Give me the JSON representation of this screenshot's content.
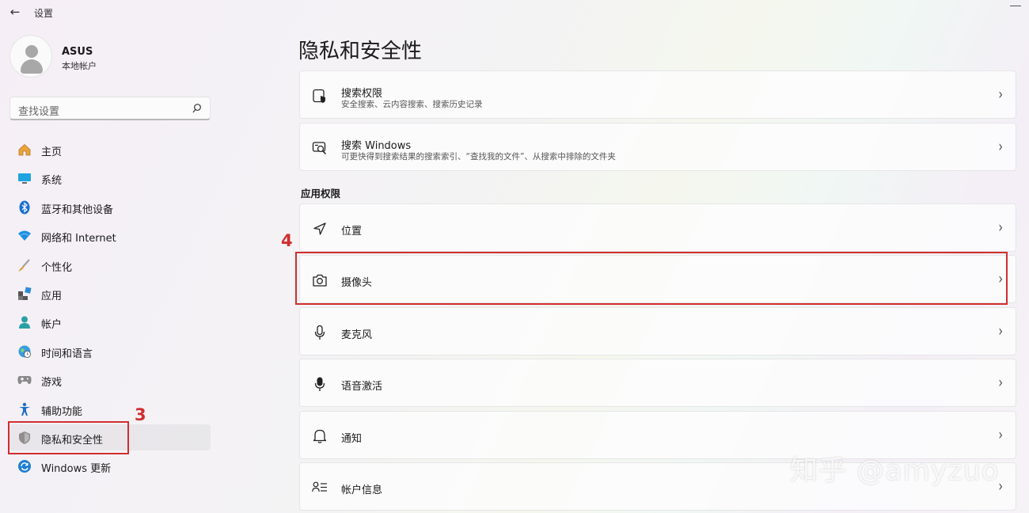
{
  "window": {
    "app_title": "设置"
  },
  "profile": {
    "name": "ASUS",
    "account_type": "本地帐户"
  },
  "search": {
    "placeholder": "查找设置"
  },
  "sidebar": {
    "items": [
      {
        "label": "主页",
        "icon": "home-icon"
      },
      {
        "label": "系统",
        "icon": "system-icon"
      },
      {
        "label": "蓝牙和其他设备",
        "icon": "bluetooth-icon"
      },
      {
        "label": "网络和 Internet",
        "icon": "wifi-icon"
      },
      {
        "label": "个性化",
        "icon": "brush-icon"
      },
      {
        "label": "应用",
        "icon": "apps-icon"
      },
      {
        "label": "帐户",
        "icon": "account-icon"
      },
      {
        "label": "时间和语言",
        "icon": "globe-clock-icon"
      },
      {
        "label": "游戏",
        "icon": "gamepad-icon"
      },
      {
        "label": "辅助功能",
        "icon": "accessibility-icon"
      },
      {
        "label": "隐私和安全性",
        "icon": "shield-icon",
        "selected": true
      },
      {
        "label": "Windows 更新",
        "icon": "update-icon"
      }
    ]
  },
  "main": {
    "title": "隐私和安全性",
    "top_cards": [
      {
        "title": "搜索权限",
        "desc": "安全搜索、云内容搜索、搜索历史记录",
        "icon": "search-permission-icon"
      },
      {
        "title": "搜索 Windows",
        "desc": "可更快得到搜索结果的搜索索引、“查找我的文件”、从搜索中排除的文件夹",
        "icon": "search-windows-icon"
      }
    ],
    "section_label": "应用权限",
    "app_permissions": [
      {
        "title": "位置",
        "icon": "location-icon"
      },
      {
        "title": "摄像头",
        "icon": "camera-icon"
      },
      {
        "title": "麦克风",
        "icon": "microphone-icon"
      },
      {
        "title": "语音激活",
        "icon": "voice-activation-icon"
      },
      {
        "title": "通知",
        "icon": "bell-icon"
      },
      {
        "title": "帐户信息",
        "icon": "account-info-icon"
      }
    ]
  },
  "annotations": {
    "step3": "3",
    "step4": "4"
  },
  "watermark": "知乎 @amyzuo",
  "colors": {
    "annotation_red": "#d12e2e",
    "accent_blue": "#0067c0"
  }
}
